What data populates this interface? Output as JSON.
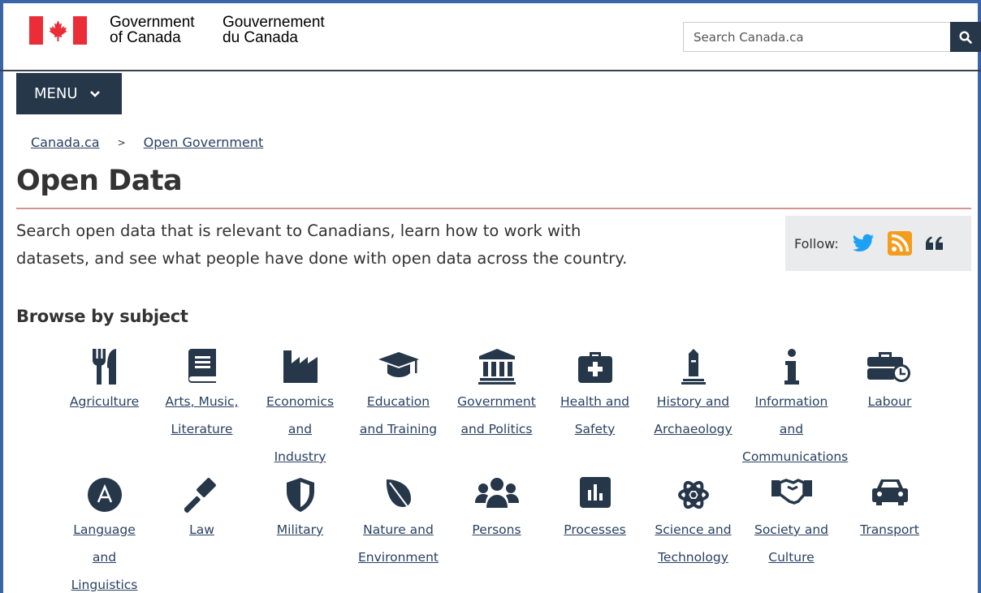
{
  "header": {
    "sig_en_1": "Government",
    "sig_en_2": "of Canada",
    "sig_fr_1": "Gouvernement",
    "sig_fr_2": "du Canada",
    "search_placeholder": "Search Canada.ca"
  },
  "menu": {
    "label": "MENU"
  },
  "breadcrumb": {
    "items": [
      "Canada.ca",
      "Open Government"
    ],
    "separator": ">"
  },
  "page": {
    "title": "Open Data",
    "lead_line1": "Search open data that is relevant to Canadians, learn how to work with",
    "lead_line2": "datasets, and see what people have done with open data across the country."
  },
  "follow": {
    "label": "Follow:"
  },
  "browse": {
    "heading": "Browse by subject",
    "row1": [
      {
        "lines": [
          "Agriculture"
        ],
        "icon": "utensils-icon"
      },
      {
        "lines": [
          "Arts, Music,",
          "Literature"
        ],
        "icon": "book-icon"
      },
      {
        "lines": [
          "Economics",
          "and",
          "Industry"
        ],
        "icon": "factory-icon"
      },
      {
        "lines": [
          "Education",
          "and Training"
        ],
        "icon": "graduation-cap-icon"
      },
      {
        "lines": [
          "Government",
          "and Politics"
        ],
        "icon": "institution-icon"
      },
      {
        "lines": [
          "Health and",
          "Safety"
        ],
        "icon": "medkit-icon"
      },
      {
        "lines": [
          "History and",
          "Archaeology"
        ],
        "icon": "monument-icon"
      },
      {
        "lines": [
          "Information",
          "and",
          "Communications"
        ],
        "icon": "info-icon"
      },
      {
        "lines": [
          "Labour"
        ],
        "icon": "toolbox-clock-icon"
      }
    ],
    "row2": [
      {
        "lines": [
          "Language",
          "and",
          "Linguistics"
        ],
        "icon": "language-icon"
      },
      {
        "lines": [
          "Law"
        ],
        "icon": "gavel-icon"
      },
      {
        "lines": [
          "Military"
        ],
        "icon": "shield-icon"
      },
      {
        "lines": [
          "Nature and",
          "Environment"
        ],
        "icon": "leaf-icon"
      },
      {
        "lines": [
          "Persons"
        ],
        "icon": "users-icon"
      },
      {
        "lines": [
          "Processes"
        ],
        "icon": "bar-chart-icon"
      },
      {
        "lines": [
          "Science and",
          "Technology"
        ],
        "icon": "atom-icon"
      },
      {
        "lines": [
          "Society and",
          "Culture"
        ],
        "icon": "handshake-icon"
      },
      {
        "lines": [
          "Transport"
        ],
        "icon": "car-icon"
      }
    ]
  },
  "colors": {
    "brand_navy": "#26374a",
    "link": "#284162",
    "flag_red": "#eb2d37",
    "twitter": "#1da1f2",
    "rss": "#f49c1c"
  }
}
